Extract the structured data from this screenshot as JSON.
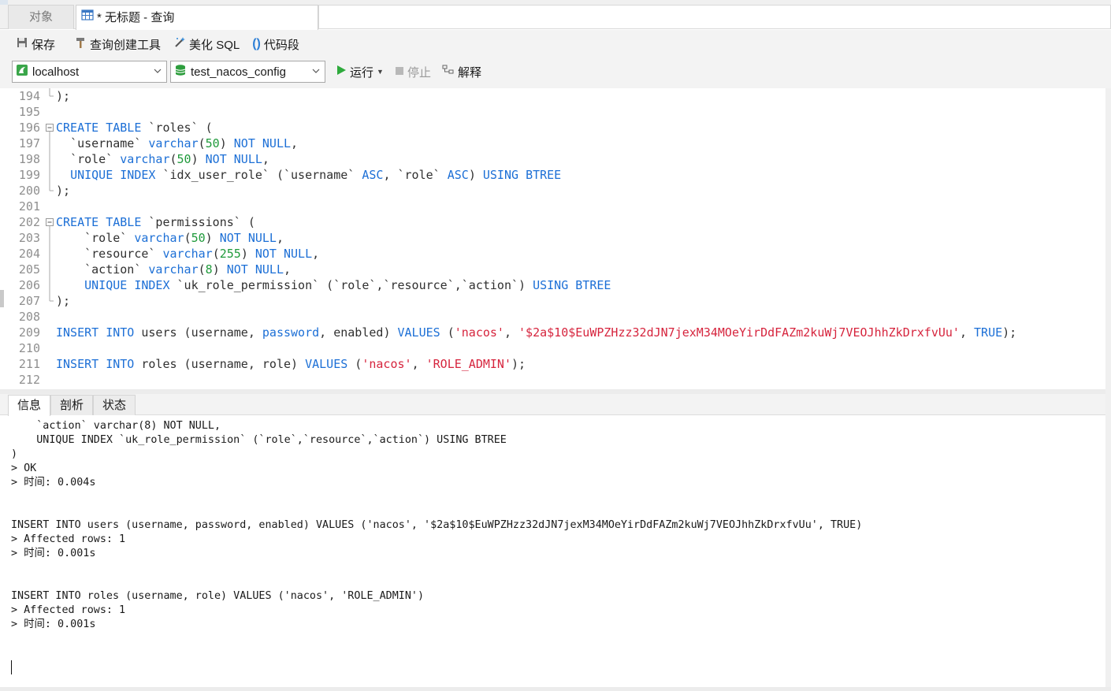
{
  "tabs": {
    "objects_label": "对象",
    "query_label": "* 无标题 - 查询"
  },
  "toolbar": {
    "save_label": "保存",
    "query_builder_label": "查询创建工具",
    "beautify_label": "美化 SQL",
    "snippet_label": "代码段"
  },
  "connection": {
    "host_value": "localhost",
    "database_value": "test_nacos_config",
    "run_label": "运行",
    "stop_label": "停止",
    "explain_label": "解释"
  },
  "editor": {
    "lines": [
      {
        "num": "194",
        "text": ");"
      },
      {
        "num": "195",
        "text": ""
      },
      {
        "num": "196",
        "text": "CREATE TABLE `roles` ("
      },
      {
        "num": "197",
        "text": "  `username` varchar(50) NOT NULL,"
      },
      {
        "num": "198",
        "text": "  `role` varchar(50) NOT NULL,"
      },
      {
        "num": "199",
        "text": "  UNIQUE INDEX `idx_user_role` (`username` ASC, `role` ASC) USING BTREE"
      },
      {
        "num": "200",
        "text": ");"
      },
      {
        "num": "201",
        "text": ""
      },
      {
        "num": "202",
        "text": "CREATE TABLE `permissions` ("
      },
      {
        "num": "203",
        "text": "    `role` varchar(50) NOT NULL,"
      },
      {
        "num": "204",
        "text": "    `resource` varchar(255) NOT NULL,"
      },
      {
        "num": "205",
        "text": "    `action` varchar(8) NOT NULL,"
      },
      {
        "num": "206",
        "text": "    UNIQUE INDEX `uk_role_permission` (`role`,`resource`,`action`) USING BTREE"
      },
      {
        "num": "207",
        "text": ");"
      },
      {
        "num": "208",
        "text": ""
      },
      {
        "num": "209",
        "text": "INSERT INTO users (username, password, enabled) VALUES ('nacos', '$2a$10$EuWPZHzz32dJN7jexM34MOeYirDdFAZm2kuWj7VEOJhhZkDrxfvUu', TRUE);"
      },
      {
        "num": "210",
        "text": ""
      },
      {
        "num": "211",
        "text": "INSERT INTO roles (username, role) VALUES ('nacos', 'ROLE_ADMIN');"
      },
      {
        "num": "212",
        "text": ""
      }
    ]
  },
  "bottom_tabs": {
    "info_label": "信息",
    "profile_label": "剖析",
    "status_label": "状态"
  },
  "output": {
    "lines": [
      "    `action` varchar(8) NOT NULL,",
      "    UNIQUE INDEX `uk_role_permission` (`role`,`resource`,`action`) USING BTREE",
      ")",
      "> OK",
      "> 时间: 0.004s",
      "",
      "",
      "INSERT INTO users (username, password, enabled) VALUES ('nacos', '$2a$10$EuWPZHzz32dJN7jexM34MOeYirDdFAZm2kuWj7VEOJhhZkDrxfvUu', TRUE)",
      "> Affected rows: 1",
      "> 时间: 0.001s",
      "",
      "",
      "INSERT INTO roles (username, role) VALUES ('nacos', 'ROLE_ADMIN')",
      "> Affected rows: 1",
      "> 时间: 0.001s"
    ]
  },
  "colors": {
    "keyword": "#1c6fd6",
    "number": "#1f9a3b",
    "string": "#d6243d",
    "run_green": "#2eaa3c"
  }
}
